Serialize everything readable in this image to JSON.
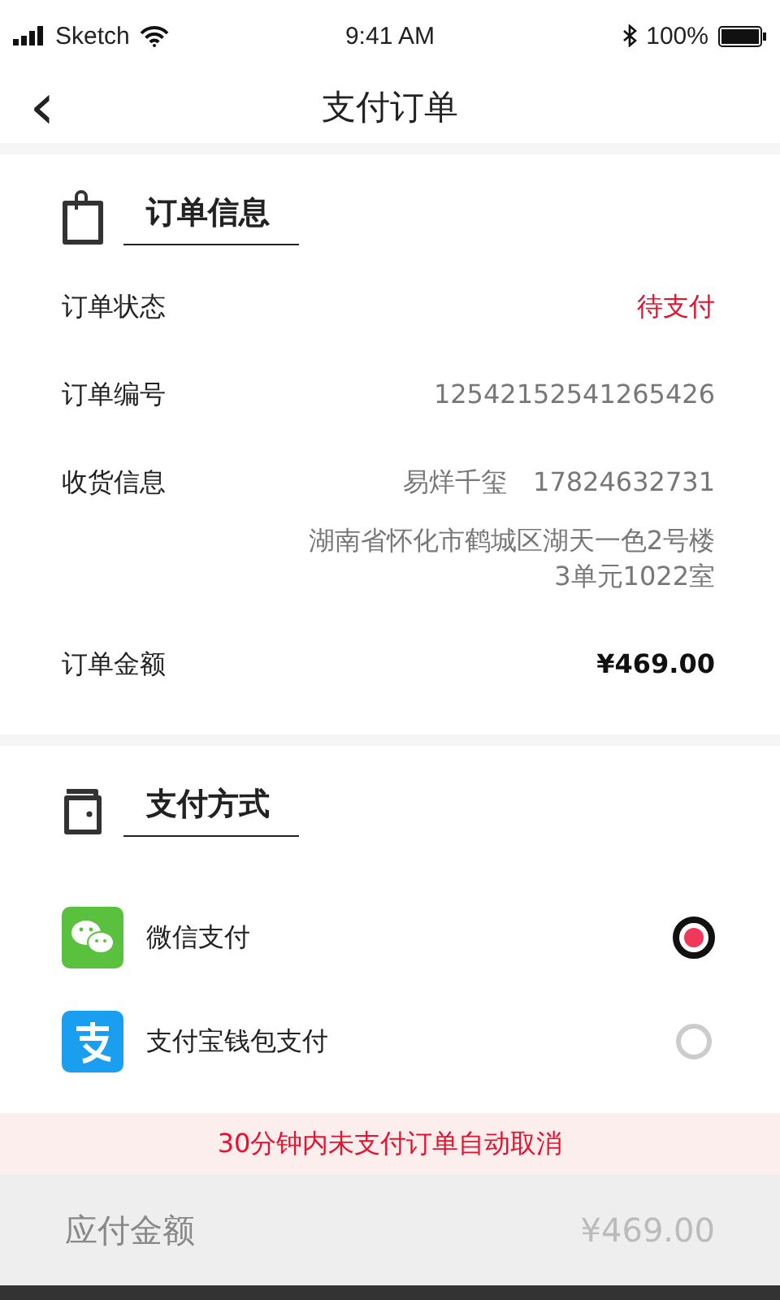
{
  "status_bar": {
    "carrier": "Sketch",
    "time": "9:41 AM",
    "battery": "100%"
  },
  "nav": {
    "back": "‹",
    "title": "支付订单"
  },
  "order": {
    "title": "订单信息",
    "rows": [
      {
        "kind": "status",
        "label": "订单状态",
        "value": "待支付"
      },
      {
        "kind": "plain",
        "label": "订单编号",
        "value": "12542152541265426"
      },
      {
        "kind": "address",
        "label": "收货信息",
        "name": "易烊千玺",
        "phone": "17824632731",
        "lines": [
          "湖南省怀化市鹤城区湖天一色2号楼",
          "3单元1022室"
        ]
      },
      {
        "kind": "amount",
        "label": "订单金额",
        "value": "¥469.00"
      }
    ]
  },
  "payment": {
    "title": "支付方式",
    "methods": [
      {
        "kind": "wechat",
        "label": "微信支付",
        "selected": true
      },
      {
        "kind": "alipay",
        "label": "支付宝钱包支付",
        "selected": false
      }
    ]
  },
  "notice": "30分钟内未支付订单自动取消",
  "footer": {
    "label": "应付金额",
    "amount": "¥469.00"
  }
}
